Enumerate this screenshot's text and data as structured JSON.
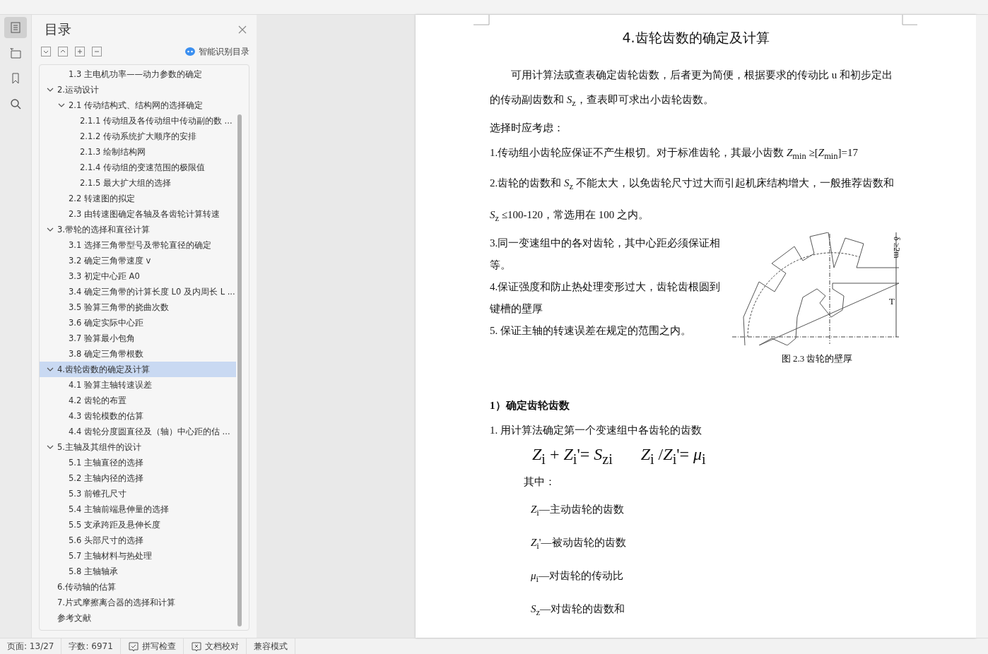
{
  "rail": [
    {
      "kind": "outline",
      "selected": true
    },
    {
      "kind": "structure",
      "selected": false
    },
    {
      "kind": "bookmark",
      "selected": false
    },
    {
      "kind": "search",
      "selected": false
    }
  ],
  "toc": {
    "title": "目录",
    "smart_button": "智能识别目录",
    "tools": [
      {
        "kind": "down"
      },
      {
        "kind": "up"
      },
      {
        "kind": "plus"
      },
      {
        "kind": "minus"
      }
    ],
    "items": [
      {
        "children": [
          {
            "label": "1.3 主电机功率——动力参数的确定",
            "selected": false
          }
        ]
      },
      {
        "label": "2.运动设计",
        "selected": false,
        "expanded": true,
        "children": [
          {
            "label": "2.1 传动结构式、结构网的选择确定",
            "selected": false,
            "expanded": true,
            "children": [
              {
                "label": "2.1.1 传动组及各传动组中传动副的数 ...",
                "selected": false
              },
              {
                "label": "2.1.2  传动系统扩大顺序的安排",
                "selected": false
              },
              {
                "label": "2.1.3  绘制结构网",
                "selected": false
              },
              {
                "label": "2.1.4  传动组的变速范围的极限值",
                "selected": false
              },
              {
                "label": "2.1.5 最大扩大组的选择",
                "selected": false
              }
            ]
          },
          {
            "label": "2.2 转速图的拟定",
            "selected": false
          },
          {
            "label": "2.3  由转速图确定各轴及各齿轮计算转速",
            "selected": false
          }
        ]
      },
      {
        "label": "3.带轮的选择和直径计算",
        "selected": false,
        "expanded": true,
        "children": [
          {
            "label": "3.1 选择三角带型号及带轮直径的确定",
            "selected": false
          },
          {
            "label": "3.2 确定三角带速度 v",
            "selected": false
          },
          {
            "label": "3.3 初定中心距 A0",
            "selected": false
          },
          {
            "label": "3.4 确定三角带的计算长度 L0 及内周长 L ...",
            "selected": false
          },
          {
            "label": "3.5 验算三角带的挠曲次数",
            "selected": false
          },
          {
            "label": "3.6 确定实际中心距",
            "selected": false
          },
          {
            "label": "3.7 验算最小包角",
            "selected": false
          },
          {
            "label": "3.8 确定三角带根数",
            "selected": false
          }
        ]
      },
      {
        "label": "4.齿轮齿数的确定及计算",
        "selected": true,
        "expanded": true,
        "children": [
          {
            "label": "4.1 验算主轴转速误差",
            "selected": false
          },
          {
            "label": "4.2 齿轮的布置",
            "selected": false
          },
          {
            "label": "4.3  齿轮模数的估算",
            "selected": false
          },
          {
            "label": "4.4  齿轮分度圆直径及（轴）中心距的估 ...",
            "selected": false
          }
        ]
      },
      {
        "label": "5.主轴及其组件的设计",
        "selected": false,
        "expanded": true,
        "children": [
          {
            "label": "5.1 主轴直径的选择",
            "selected": false
          },
          {
            "label": "5.2 主轴内径的选择",
            "selected": false
          },
          {
            "label": "5.3 前锥孔尺寸",
            "selected": false
          },
          {
            "label": "5.4 主轴前端悬伸量的选择",
            "selected": false
          },
          {
            "label": "5.5 支承跨距及悬伸长度",
            "selected": false
          },
          {
            "label": "5.6 头部尺寸的选择",
            "selected": false
          },
          {
            "label": "5.7 主轴材料与热处理",
            "selected": false
          },
          {
            "label": "5.8 主轴轴承",
            "selected": false
          }
        ]
      },
      {
        "label": "6.传动轴的估算",
        "selected": false
      },
      {
        "label": "7.片式摩擦离合器的选择和计算",
        "selected": false
      },
      {
        "label": "参考文献",
        "selected": false
      }
    ]
  },
  "document": {
    "heading": "4.齿轮齿数的确定及计算",
    "intro": "可用计算法或查表确定齿轮齿数，后者更为简便，根据要求的传动比 u 和初步定出的传动副齿数和 *S*$_{z}$，查表即可求出小齿轮齿数。",
    "consider": "选择时应考虑：",
    "point_1": "1.传动组小齿轮应保证不产生根切。对于标准齿轮，其最小齿数 *Z*$_{min}$ ≥[*Z*$_{min}$]=17",
    "point_2": "2.齿轮的齿数和 *S*$_{z}$ 不能太大，以免齿轮尺寸过大而引起机床结构增大，一般推荐齿数和 *S*$_{z}$ ≤100-120，常选用在 100 之内。",
    "side_points": [
      "3.同一变速组中的各对齿轮，其中心距必须保证相等。",
      "4.保证强度和防止热处理变形过大，齿轮齿根圆到键槽的壁厚",
      "5.  保证主轴的转速误差在规定的范围之内。"
    ],
    "figure_caption": "图 2.3  齿轮的壁厚",
    "figure_label": "δ ≥2m",
    "figure_t_label": "T",
    "subheading": "1）确定齿轮齿数",
    "step": "1.  用计算法确定第一个变速组中各齿轮的齿数",
    "formulas": [
      "*Z*$_{i}$ + *Z*$_{i}$'= *S*$_{zi}$",
      "*Z*$_{i}$ /*Z*$_{i}$'= *μ*$_{i}$"
    ],
    "where": "其中：",
    "definitions": [
      "*Z*$_{i}$—主动齿轮的齿数",
      "*Z*$_{i}$'—被动齿轮的齿数",
      "*μ*$_{i}$—对齿轮的传动比",
      "*S*$_{z}$—对齿轮的齿数和"
    ]
  },
  "status_bar": [
    {
      "kind": "text",
      "label": "页面: 13/27"
    },
    {
      "kind": "text",
      "label": "字数: 6971"
    },
    {
      "kind": "spell",
      "label": "拼写检查"
    },
    {
      "kind": "proof",
      "label": "文档校对"
    },
    {
      "kind": "text",
      "label": "兼容模式"
    }
  ]
}
